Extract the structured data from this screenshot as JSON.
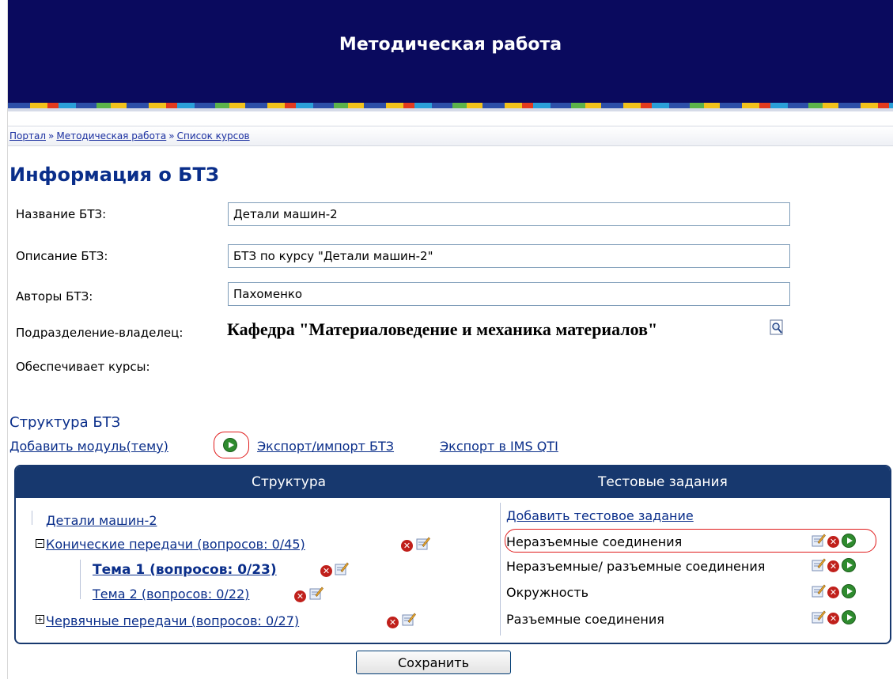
{
  "banner": {
    "title": "Методическая работа"
  },
  "breadcrumb": {
    "items": [
      "Портал",
      "Методическая работа",
      "Список курсов"
    ],
    "separator": "»"
  },
  "info": {
    "heading": "Информация о БТЗ",
    "name_label": "Название БТЗ:",
    "name_value": "Детали машин-2",
    "desc_label": "Описание БТЗ:",
    "desc_value": "БТЗ по курсу \"Детали машин-2\"",
    "authors_label": "Авторы БТЗ:",
    "authors_value": "Пахоменко",
    "dept_label": "Подразделение-владелец:",
    "dept_value": "Кафедра \"Материаловедение и механика материалов\"",
    "courses_label": "Обеспечивает курсы:"
  },
  "structure": {
    "heading": "Структура БТЗ",
    "add_module": "Добавить модуль(тему)",
    "export_import": "Экспорт/импорт БТЗ",
    "export_ims": "Экспорт в IMS QTI",
    "col_structure": "Структура",
    "col_tasks": "Тестовые задания",
    "tree": {
      "root": "Детали машин-2",
      "node1": "Конические передачи (вопросов: 0/45)",
      "node1_child1": "Тема 1 (вопросов: 0/23)",
      "node1_child2": "Тема 2 (вопросов: 0/22)",
      "node2": "Червячные передачи (вопросов: 0/27)"
    },
    "add_task": "Добавить тестовое задание",
    "tasks": [
      "Неразъемные соединения",
      "Неразъемные/ разъемные соединения",
      "Окружность",
      "Разъемные соединения"
    ]
  },
  "footer": {
    "save_label": "Сохранить"
  },
  "icons": {
    "delete": "delete-icon",
    "edit": "edit-icon",
    "play": "play-icon",
    "zoom": "magnifier-icon"
  },
  "colors": {
    "banner": "#0a0a5e",
    "accent": "#0a2e8a",
    "grid_head": "#17386e",
    "highlight": "#e01b1b"
  }
}
